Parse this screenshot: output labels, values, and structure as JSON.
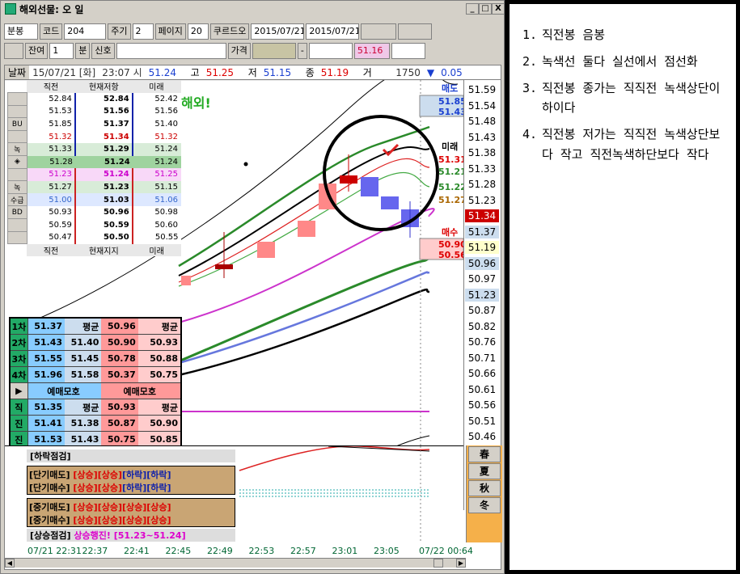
{
  "window": {
    "title": "해외선물: 오 일",
    "minimize": "_",
    "restore": "□",
    "close": "X"
  },
  "toolbar": {
    "type_select": "분봉",
    "code_label": "코드",
    "code_value": "204",
    "period_label": "주기",
    "period_value": "2",
    "page_label": "페이지",
    "page_value": "20",
    "cursor_label": "쿠르드오",
    "date_from": "2015/07/21",
    "date_to": "2015/07/21",
    "remain_label": "잔여",
    "remain_value": "1",
    "minute_label": "분",
    "signal_label": "신호",
    "price_label": "가격",
    "dash": "-",
    "price_value": "51.16"
  },
  "infobar": {
    "date_label": "날짜",
    "date_value": "15/07/21 [화]",
    "time_label": "23:07 시",
    "open": "51.24",
    "high_label": "고",
    "high": "51.25",
    "low_label": "저",
    "low": "51.15",
    "close_label": "종",
    "close": "51.19",
    "vol_label": "거",
    "volume": "1750",
    "change": "0.05",
    "annotation": "해외!"
  },
  "orderbook": {
    "header": [
      "직전",
      "현재저항",
      "미래"
    ],
    "footer": [
      "직전",
      "현재지지",
      "미래"
    ],
    "rows": [
      {
        "tag": "",
        "a": "52.84",
        "b": "52.84",
        "c": "52.42"
      },
      {
        "tag": "",
        "a": "51.53",
        "b": "51.56",
        "c": "51.56"
      },
      {
        "tag": "BU",
        "a": "51.85",
        "b": "51.37",
        "c": "51.40"
      },
      {
        "tag": "",
        "a": "51.32",
        "b": "51.34",
        "c": "51.32"
      },
      {
        "tag": "녹",
        "a": "51.33",
        "b": "51.29",
        "c": "51.24"
      },
      {
        "tag": "◈",
        "a": "51.28",
        "b": "51.24",
        "c": "51.24"
      },
      {
        "tag": "",
        "a": "51.23",
        "b": "51.24",
        "c": "51.25"
      },
      {
        "tag": "녹",
        "a": "51.27",
        "b": "51.23",
        "c": "51.15"
      },
      {
        "tag": "수급",
        "a": "51.00",
        "b": "51.03",
        "c": "51.06"
      },
      {
        "tag": "BD",
        "a": "50.93",
        "b": "50.96",
        "c": "50.98"
      },
      {
        "tag": "",
        "a": "50.59",
        "b": "50.59",
        "c": "50.60"
      },
      {
        "tag": "",
        "a": "50.47",
        "b": "50.50",
        "c": "50.55"
      }
    ]
  },
  "summary": {
    "rows1": [
      {
        "label": "1차",
        "b": "51.37",
        "bavg": "평균",
        "s": "50.96",
        "savg": "평균"
      },
      {
        "label": "2차",
        "b": "51.43",
        "bavg": "51.40",
        "s": "50.90",
        "savg": "50.93"
      },
      {
        "label": "3차",
        "b": "51.55",
        "bavg": "51.45",
        "s": "50.78",
        "savg": "50.88"
      },
      {
        "label": "4차",
        "b": "51.96",
        "bavg": "51.58",
        "s": "50.37",
        "savg": "50.75"
      }
    ],
    "mid_left": "예매모호",
    "mid_right": "예매모호",
    "rows2": [
      {
        "label": "직",
        "b": "51.35",
        "bavg": "평균",
        "s": "50.93",
        "savg": "평균"
      },
      {
        "label": "진",
        "b": "51.41",
        "bavg": "51.38",
        "s": "50.87",
        "savg": "50.90"
      },
      {
        "label": "진",
        "b": "51.53",
        "bavg": "51.43",
        "s": "50.75",
        "savg": "50.85"
      },
      {
        "label": "입",
        "b": "51.95",
        "bavg": "51.56",
        "s": "50.33",
        "savg": "50.72"
      }
    ]
  },
  "price_axis": {
    "labels": [
      "51.59",
      "51.54",
      "51.48",
      "51.43",
      "51.38",
      "51.33",
      "51.28",
      "51.23",
      "51.34",
      "51.37",
      "51.19",
      "50.96",
      "50.97",
      "51.23",
      "50.87",
      "50.82",
      "50.76",
      "50.71",
      "50.66",
      "50.61",
      "50.56",
      "50.51",
      "50.46"
    ],
    "sell_label": "매도",
    "sell1": "51.85",
    "sell2": "51.43",
    "future_label": "미래",
    "f1": "51.31",
    "f2": "51.21",
    "f3": "51.22",
    "f4": "51.27",
    "buy_label": "매수",
    "buy1": "50.90",
    "buy2": "50.56"
  },
  "sub_panel": {
    "title": "[하락점검]",
    "short_sell": "[단기매도]",
    "short_buy": "[단기매수]",
    "short_sell_vals": [
      "[상승]",
      "[상승]",
      "[하락]",
      "[하락]"
    ],
    "short_buy_vals": [
      "[상승]",
      "[상승]",
      "[하락]",
      "[하락]"
    ],
    "mid_sell": "[중기매도]",
    "mid_buy": "[중기매수]",
    "mid_sell_vals": [
      "[상승]",
      "[상승]",
      "[상승]",
      "[상승]"
    ],
    "mid_buy_vals": [
      "[상승]",
      "[상승]",
      "[상승]",
      "[상승]"
    ],
    "status_label": "[상승점검]",
    "status_text": "상승행진!",
    "status_range": "[51.23~51.24]"
  },
  "seasons": [
    "春",
    "夏",
    "秋",
    "冬"
  ],
  "time_axis": [
    "07/21 22:31",
    "22:37",
    "22:41",
    "22:45",
    "22:49",
    "22:53",
    "22:57",
    "23:01",
    "23:05",
    "07/22 00:64"
  ],
  "notes": [
    {
      "num": "1.",
      "text": "직전봉 음봉"
    },
    {
      "num": "2.",
      "text": "녹색선 둘다 실선에서 점선화"
    },
    {
      "num": "3.",
      "text": "직전봉 종가는 직직전 녹색상단이하이다"
    },
    {
      "num": "4.",
      "text": "직전봉 저가는 직직전 녹색상단보다 작고 직전녹색하단보다 작다"
    }
  ]
}
